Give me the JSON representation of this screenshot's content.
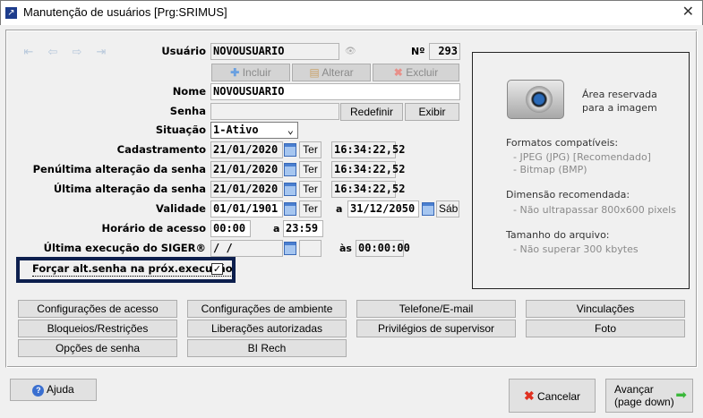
{
  "window": {
    "title": "Manutenção de usuários [Prg:SRIMUS]",
    "close": "✕"
  },
  "nav": {
    "first": "⇤",
    "prev": "⇦",
    "next": "⇨",
    "last": "⇥"
  },
  "form": {
    "usuario_label": "Usuário",
    "usuario": "NOVOUSUARIO",
    "numero_label": "Nº",
    "numero": "293",
    "incluir": "Incluir",
    "alterar": "Alterar",
    "excluir": "Excluir",
    "nome_label": "Nome",
    "nome": "NOVOUSUARIO",
    "senha_label": "Senha",
    "senha": "",
    "redefinir": "Redefinir",
    "exibir": "Exibir",
    "situacao_label": "Situação",
    "situacao": "1-Ativo",
    "cadastro_label": "Cadastramento",
    "cadastro_data": "21/01/2020",
    "cadastro_dia": "Ter",
    "cadastro_hora": "16:34:22,52",
    "penult_label": "Penúltima alteração da senha",
    "penult_data": "21/01/2020",
    "penult_dia": "Ter",
    "penult_hora": "16:34:22,52",
    "ult_label": "Última alteração da senha",
    "ult_data": "21/01/2020",
    "ult_dia": "Ter",
    "ult_hora": "16:34:22,52",
    "validade_label": "Validade",
    "validade_de": "01/01/1901",
    "validade_de_dia": "Ter",
    "a": "a",
    "validade_ate": "31/12/2050",
    "validade_ate_dia": "Sáb",
    "horario_label": "Horário de acesso",
    "horario_de": "00:00",
    "horario_ate": "23:59",
    "exec_label": "Última execução do SIGER®",
    "exec_data": " / /",
    "exec_dia": "",
    "as": "às",
    "exec_hora": "00:00:00",
    "forcar_label": "Forçar alt.senha na próx.execução",
    "forcar_checked": true
  },
  "image_panel": {
    "reserved": "Área reservada",
    "reserved2": "para a imagem",
    "formats_title": "Formatos compatíveis:",
    "format1": "- JPEG (JPG) [Recomendado]",
    "format2": "- Bitmap (BMP)",
    "dim_title": "Dimensão recomendada:",
    "dim1": "- Não ultrapassar 800x600 pixels",
    "size_title": "Tamanho do arquivo:",
    "size1": "- Não superar 300 kbytes"
  },
  "buttons": [
    "Configurações de acesso",
    "Configurações de ambiente",
    "Telefone/E-mail",
    "Vinculações",
    "Bloqueios/Restrições",
    "Liberações autorizadas",
    "Privilégios de supervisor",
    "Foto",
    "Opções de senha",
    "BI Rech"
  ],
  "footer": {
    "ajuda": "Ajuda",
    "cancelar": "Cancelar",
    "avancar": "Avançar",
    "avancar2": "(page down)"
  }
}
